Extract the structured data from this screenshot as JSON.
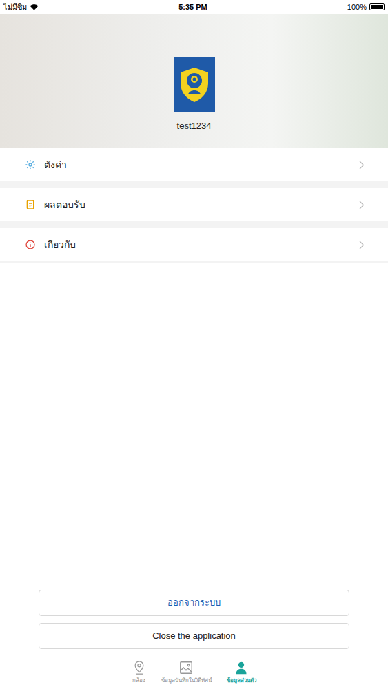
{
  "status_bar": {
    "carrier": "ไม่มีซิม",
    "time": "5:35 PM",
    "battery": "100%",
    "battery_level": 1
  },
  "profile": {
    "username": "test1234"
  },
  "menu": [
    {
      "label": "ตังค่า",
      "kind": "settings",
      "color": "#5aaee0"
    },
    {
      "label": "ผลตอบรับ",
      "kind": "feedback",
      "color": "#e8a200"
    },
    {
      "label": "เกียวกับ",
      "kind": "about",
      "color": "#e0463c"
    }
  ],
  "buttons": [
    {
      "label": "ออกจากระบบ",
      "kind": "logout"
    },
    {
      "label": "Close the application",
      "kind": "close"
    }
  ],
  "tabs": [
    {
      "label": "กล้อง",
      "kind": "camera",
      "selected": false
    },
    {
      "label": "ข้อมูลบันทึกในวิดีทัศน์",
      "kind": "media",
      "selected": false
    },
    {
      "label": "ข้อมูลส่วนตัว",
      "kind": "profile",
      "selected": true
    }
  ]
}
